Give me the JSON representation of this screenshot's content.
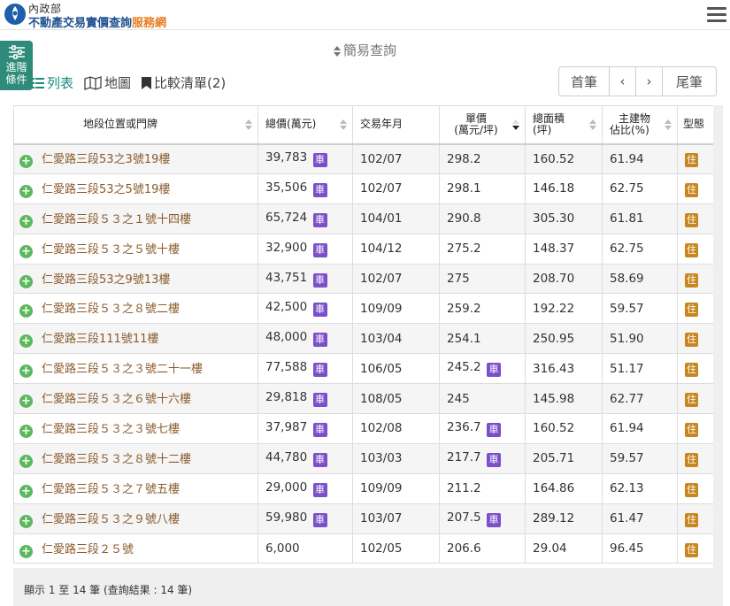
{
  "header": {
    "agency": "內政部",
    "title_main": "不動產交易實價查詢",
    "title_accent": "服務網"
  },
  "simple_query": "簡易查詢",
  "advanced": {
    "line1": "進階",
    "line2": "條件"
  },
  "view_tabs": {
    "list": "列表",
    "map": "地圖",
    "compare": "比較清單(2)"
  },
  "pager": {
    "first": "首筆",
    "prev": "‹",
    "next": "›",
    "last": "尾筆"
  },
  "table": {
    "headers": {
      "address": "地段位置或門牌",
      "total_price": "總價(萬元)",
      "trade_date": "交易年月",
      "unit_price_1": "單價",
      "unit_price_2": "(萬元/坪)",
      "area_1": "總面積",
      "area_2": "(坪)",
      "main_ratio_1": "主建物",
      "main_ratio_2": "佔比(%)",
      "type": "型態"
    },
    "badge_car": "車",
    "badge_res": "住",
    "rows": [
      {
        "address": "仁愛路三段53之3號19樓",
        "total": "39,783",
        "total_car": true,
        "date": "102/07",
        "unit": "298.2",
        "unit_car": false,
        "area": "160.52",
        "ratio": "61.94"
      },
      {
        "address": "仁愛路三段53之5號19樓",
        "total": "35,506",
        "total_car": true,
        "date": "102/07",
        "unit": "298.1",
        "unit_car": false,
        "area": "146.18",
        "ratio": "62.75"
      },
      {
        "address": "仁愛路三段５３之１號十四樓",
        "total": "65,724",
        "total_car": true,
        "date": "104/01",
        "unit": "290.8",
        "unit_car": false,
        "area": "305.30",
        "ratio": "61.81"
      },
      {
        "address": "仁愛路三段５３之５號十樓",
        "total": "32,900",
        "total_car": true,
        "date": "104/12",
        "unit": "275.2",
        "unit_car": false,
        "area": "148.37",
        "ratio": "62.75"
      },
      {
        "address": "仁愛路三段53之9號13樓",
        "total": "43,751",
        "total_car": true,
        "date": "102/07",
        "unit": "275",
        "unit_car": false,
        "area": "208.70",
        "ratio": "58.69"
      },
      {
        "address": "仁愛路三段５３之８號二樓",
        "total": "42,500",
        "total_car": true,
        "date": "109/09",
        "unit": "259.2",
        "unit_car": false,
        "area": "192.22",
        "ratio": "59.57"
      },
      {
        "address": "仁愛路三段111號11樓",
        "total": "48,000",
        "total_car": true,
        "date": "103/04",
        "unit": "254.1",
        "unit_car": false,
        "area": "250.95",
        "ratio": "51.90"
      },
      {
        "address": "仁愛路三段５３之３號二十一樓",
        "total": "77,588",
        "total_car": true,
        "date": "106/05",
        "unit": "245.2",
        "unit_car": true,
        "area": "316.43",
        "ratio": "51.17"
      },
      {
        "address": "仁愛路三段５３之６號十六樓",
        "total": "29,818",
        "total_car": true,
        "date": "108/05",
        "unit": "245",
        "unit_car": false,
        "area": "145.98",
        "ratio": "62.77"
      },
      {
        "address": "仁愛路三段５３之３號七樓",
        "total": "37,987",
        "total_car": true,
        "date": "102/08",
        "unit": "236.7",
        "unit_car": true,
        "area": "160.52",
        "ratio": "61.94"
      },
      {
        "address": "仁愛路三段５３之８號十二樓",
        "total": "44,780",
        "total_car": true,
        "date": "103/03",
        "unit": "217.7",
        "unit_car": true,
        "area": "205.71",
        "ratio": "59.57"
      },
      {
        "address": "仁愛路三段５３之７號五樓",
        "total": "29,000",
        "total_car": true,
        "date": "109/09",
        "unit": "211.2",
        "unit_car": false,
        "area": "164.86",
        "ratio": "62.13"
      },
      {
        "address": "仁愛路三段５３之９號八樓",
        "total": "59,980",
        "total_car": true,
        "date": "103/07",
        "unit": "207.5",
        "unit_car": true,
        "area": "289.12",
        "ratio": "61.47"
      },
      {
        "address": "仁愛路三段２５號",
        "total": "6,000",
        "total_car": false,
        "date": "102/05",
        "unit": "206.6",
        "unit_car": false,
        "area": "29.04",
        "ratio": "96.45"
      }
    ]
  },
  "footer": "顯示 1 至 14 筆 (查詢結果 : 14 筆)"
}
